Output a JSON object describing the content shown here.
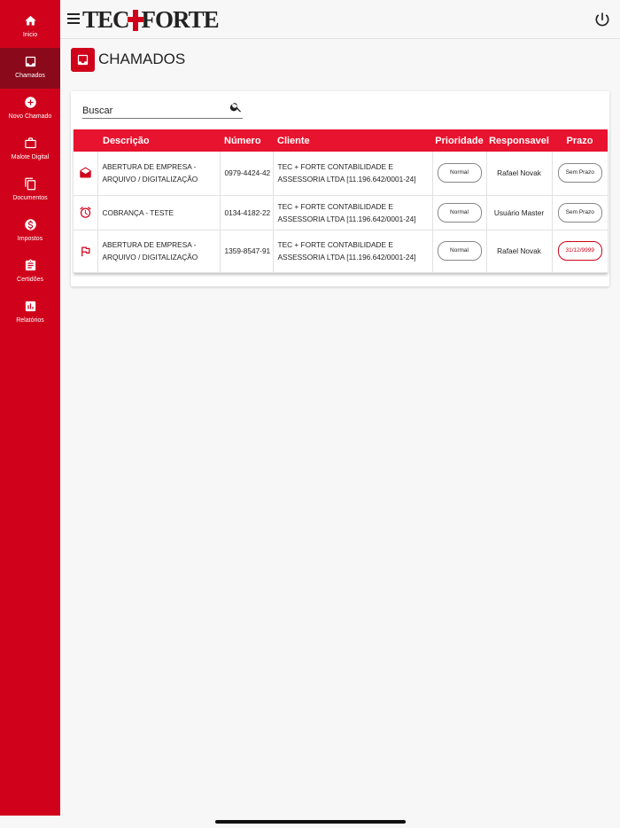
{
  "sidebar": {
    "items": [
      {
        "label": "Inicio",
        "icon": "home-icon",
        "active": false
      },
      {
        "label": "Chamados",
        "icon": "inbox-icon",
        "active": true
      },
      {
        "label": "Novo Chamado",
        "icon": "add-circle-icon",
        "active": false
      },
      {
        "label": "Malote Digital",
        "icon": "briefcase-icon",
        "active": false
      },
      {
        "label": "Documentos",
        "icon": "documents-icon",
        "active": false
      },
      {
        "label": "Impostos",
        "icon": "dollar-icon",
        "active": false
      },
      {
        "label": "Certidões",
        "icon": "clipboard-icon",
        "active": false
      },
      {
        "label": "Relatórios",
        "icon": "bar-chart-icon",
        "active": false
      }
    ]
  },
  "header": {
    "logo_left": "TEC",
    "logo_right": "FORTE"
  },
  "page": {
    "title": "CHAMADOS"
  },
  "search": {
    "placeholder": "Buscar"
  },
  "table": {
    "columns": [
      "Descrição",
      "Número",
      "Cliente",
      "Prioridade",
      "Responsavel",
      "Prazo"
    ],
    "rows": [
      {
        "icon": "open-mail-icon",
        "descricao": "ABERTURA DE EMPRESA - ARQUIVO / DIGITALIZAÇÃO",
        "numero": "0979-4424-42",
        "cliente": "TEC + FORTE CONTABILIDADE E ASSESSORIA LTDA [11.196.642/0001-24]",
        "prioridade": "Normal",
        "responsavel": "Rafael Novak",
        "prazo": "Sem Prazo",
        "prazo_overdue": false
      },
      {
        "icon": "alarm-icon",
        "descricao": "COBRANÇA - TESTE",
        "numero": "0134-4182-22",
        "cliente": "TEC + FORTE CONTABILIDADE E ASSESSORIA LTDA [11.196.642/0001-24]",
        "prioridade": "Normal",
        "responsavel": "Usuário Master",
        "prazo": "Sem Prazo",
        "prazo_overdue": false
      },
      {
        "icon": "flag-icon",
        "descricao": "ABERTURA DE EMPRESA - ARQUIVO / DIGITALIZAÇÃO",
        "numero": "1359-8547-91",
        "cliente": "TEC + FORTE CONTABILIDADE E ASSESSORIA LTDA [11.196.642/0001-24]",
        "prioridade": "Normal",
        "responsavel": "Rafael Novak",
        "prazo": "31/12/9999",
        "prazo_overdue": true
      }
    ]
  },
  "colors": {
    "brand": "#d0021b",
    "sidebar_active": "#8a0a1b",
    "table_header": "#e8132f"
  }
}
